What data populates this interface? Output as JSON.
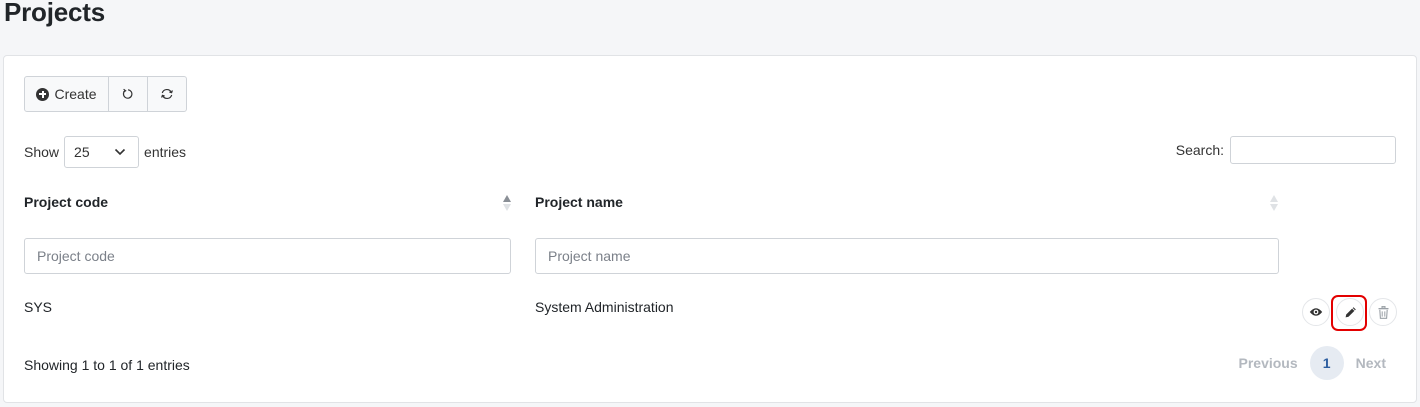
{
  "page": {
    "title": "Projects"
  },
  "toolbar": {
    "create_label": "Create",
    "create_icon": "plus-circle-icon",
    "reset_icon": "undo-icon",
    "reload_icon": "refresh-icon"
  },
  "length": {
    "prefix": "Show",
    "value": "25",
    "suffix": "entries"
  },
  "search": {
    "label": "Search:",
    "value": ""
  },
  "table": {
    "columns": [
      {
        "label": "Project code",
        "filter_placeholder": "Project code",
        "sort": "ascending"
      },
      {
        "label": "Project name",
        "filter_placeholder": "Project name",
        "sort": "none"
      }
    ],
    "rows": [
      {
        "code": "SYS",
        "name": "System Administration",
        "actions": [
          "view-icon",
          "edit-icon",
          "delete-icon"
        ]
      }
    ]
  },
  "footer": {
    "info": "Showing 1 to 1 of 1 entries",
    "previous_label": "Previous",
    "current_page": "1",
    "next_label": "Next"
  },
  "colors": {
    "highlight": "#e30000",
    "pager_active_bg": "#e6ebf2",
    "pager_active_text": "#2d5ea0"
  }
}
